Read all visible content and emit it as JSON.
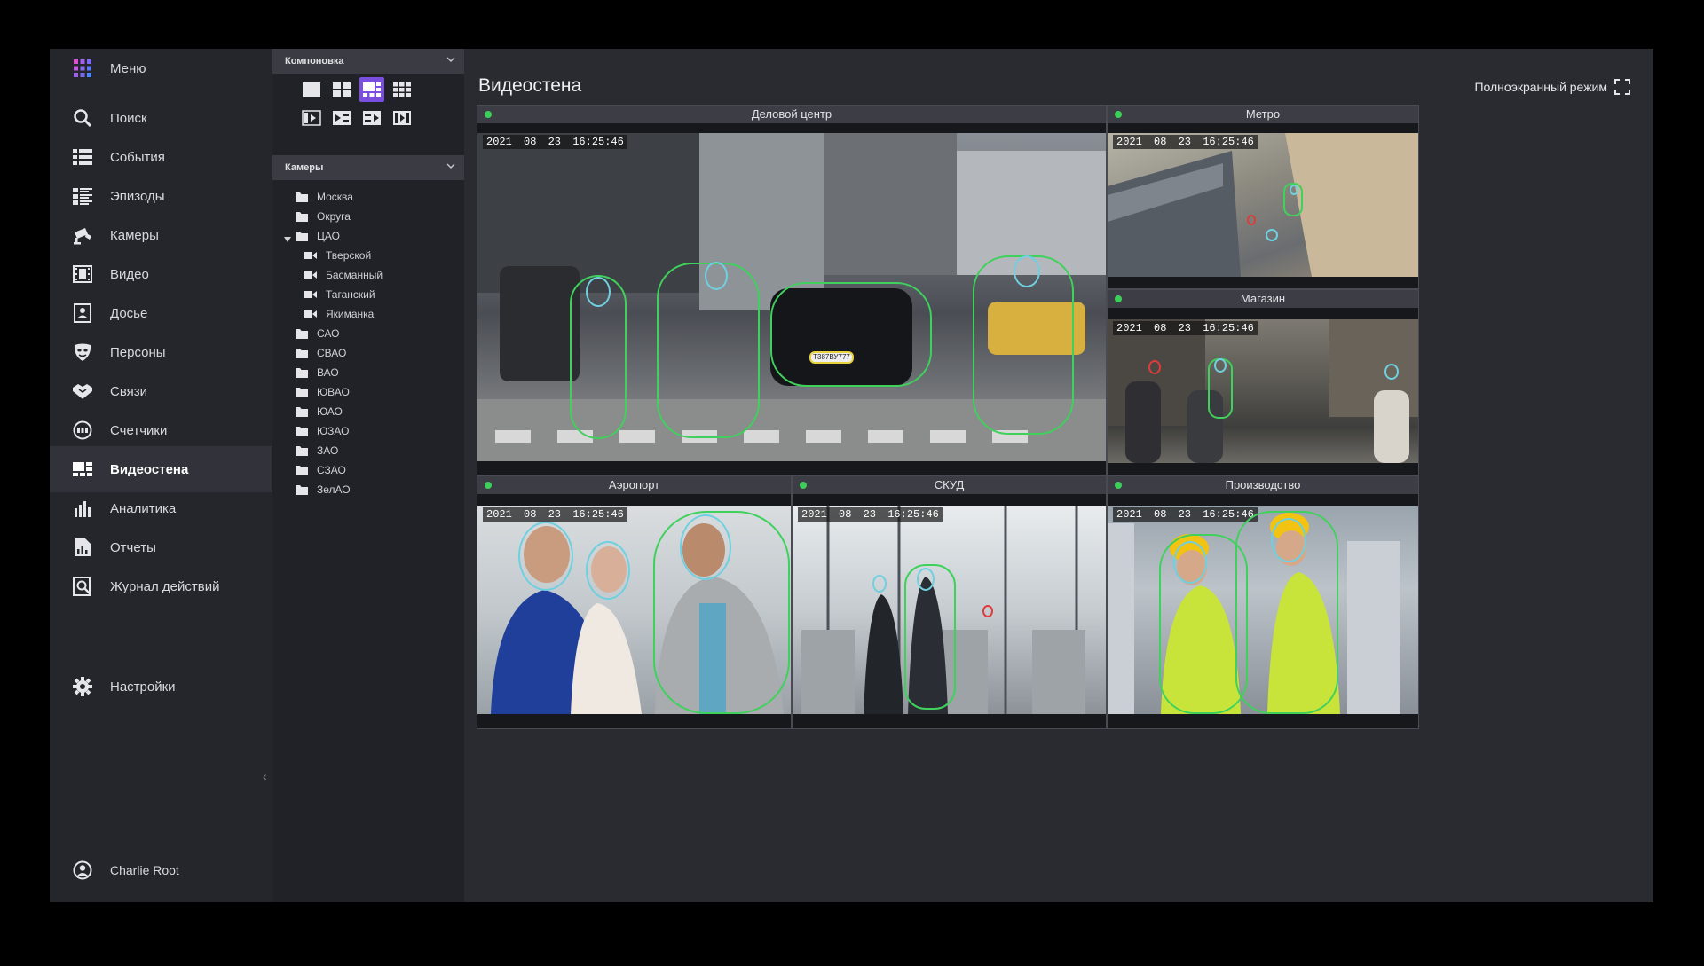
{
  "nav": {
    "menu_label": "Меню",
    "items": [
      {
        "label": "Поиск",
        "icon": "search-icon"
      },
      {
        "label": "События",
        "icon": "events-icon"
      },
      {
        "label": "Эпизоды",
        "icon": "episodes-icon"
      },
      {
        "label": "Камеры",
        "icon": "camera-icon"
      },
      {
        "label": "Видео",
        "icon": "film-icon"
      },
      {
        "label": "Досье",
        "icon": "dossier-icon"
      },
      {
        "label": "Персоны",
        "icon": "mask-icon"
      },
      {
        "label": "Связи",
        "icon": "handshake-icon"
      },
      {
        "label": "Счетчики",
        "icon": "counter-icon"
      },
      {
        "label": "Видеостена",
        "icon": "videowall-icon"
      },
      {
        "label": "Аналитика",
        "icon": "analytics-icon"
      },
      {
        "label": "Отчеты",
        "icon": "reports-icon"
      },
      {
        "label": "Журнал действий",
        "icon": "journal-icon"
      }
    ],
    "active": "Видеостена",
    "settings_label": "Настройки",
    "user_name": "Charlie Root"
  },
  "layout_panel": {
    "title": "Компоновка"
  },
  "cameras_panel": {
    "title": "Камеры",
    "tree": [
      {
        "label": "Москва",
        "type": "folder",
        "level": 0
      },
      {
        "label": "Округа",
        "type": "folder",
        "level": 0
      },
      {
        "label": "ЦАО",
        "type": "folder-open",
        "level": 0
      },
      {
        "label": "Тверской",
        "type": "camera",
        "level": 1
      },
      {
        "label": "Басманный",
        "type": "camera",
        "level": 1
      },
      {
        "label": "Таганский",
        "type": "camera",
        "level": 1
      },
      {
        "label": "Якиманка",
        "type": "camera",
        "level": 1
      },
      {
        "label": "САО",
        "type": "folder",
        "level": 0
      },
      {
        "label": "СВАО",
        "type": "folder",
        "level": 0
      },
      {
        "label": "ВАО",
        "type": "folder",
        "level": 0
      },
      {
        "label": "ЮВАО",
        "type": "folder",
        "level": 0
      },
      {
        "label": "ЮАО",
        "type": "folder",
        "level": 0
      },
      {
        "label": "ЮЗАО",
        "type": "folder",
        "level": 0
      },
      {
        "label": "ЗАО",
        "type": "folder",
        "level": 0
      },
      {
        "label": "СЗАО",
        "type": "folder",
        "level": 0
      },
      {
        "label": "ЗелАО",
        "type": "folder",
        "level": 0
      }
    ]
  },
  "main": {
    "title": "Видеостена",
    "fullscreen_label": "Полноэкранный режим",
    "cameras": [
      {
        "name": "Деловой центр",
        "timestamp": "2021 08 23 16:25:46",
        "status_color": "#3cd05a"
      },
      {
        "name": "Метро",
        "timestamp": "2021 08 23 16:25:46",
        "status_color": "#3cd05a"
      },
      {
        "name": "Магазин",
        "timestamp": "2021 08 23 16:25:46",
        "status_color": "#3cd05a"
      },
      {
        "name": "Аэропорт",
        "timestamp": "2021 08 23 16:25:46",
        "status_color": "#3cd05a"
      },
      {
        "name": "СКУД",
        "timestamp": "2021 08 23 16:25:46",
        "status_color": "#3cd05a"
      },
      {
        "name": "Производство",
        "timestamp": "2021 08 23 16:25:46",
        "status_color": "#3cd05a"
      }
    ],
    "plate_text": "Т387ВУ777"
  },
  "colors": {
    "accent": "#7a4fe0",
    "detection_box": "#3fd15c",
    "face_box": "#6fd0e0",
    "alert_face": "#e03a3a",
    "plate_box": "#e8d23a"
  }
}
